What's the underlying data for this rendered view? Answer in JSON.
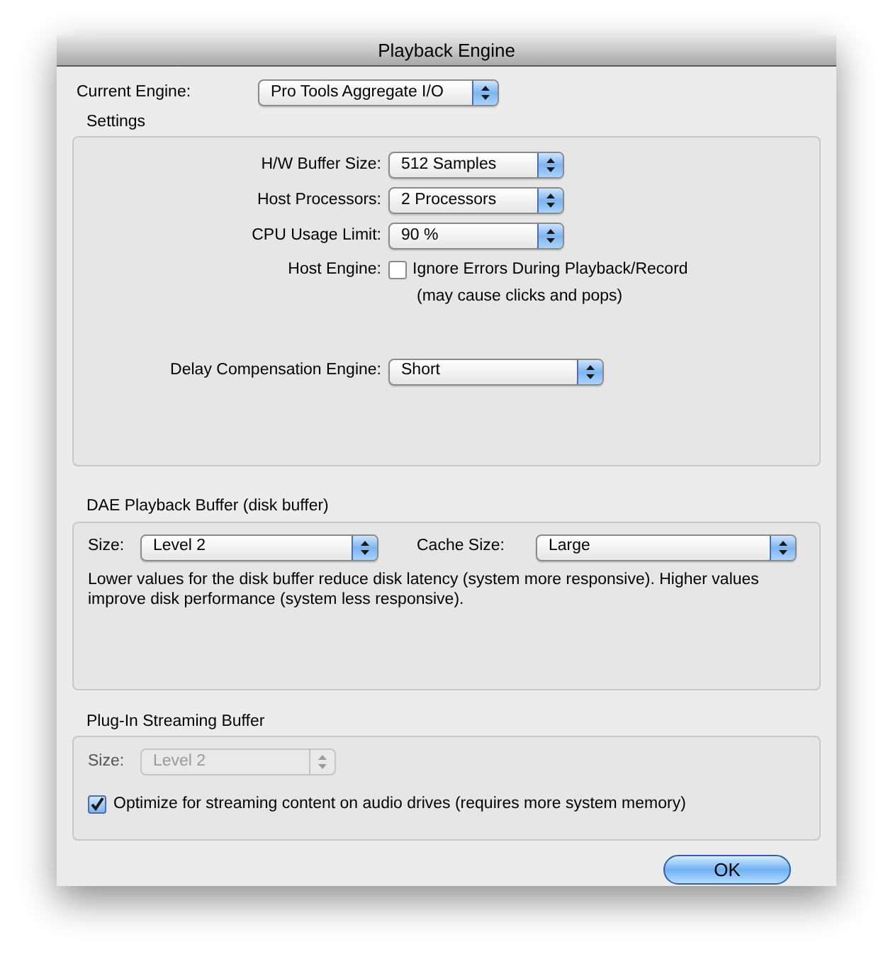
{
  "window": {
    "title": "Playback Engine"
  },
  "current_engine": {
    "label": "Current Engine:",
    "value": "Pro Tools Aggregate I/O"
  },
  "settings": {
    "title": "Settings",
    "rows": [
      {
        "kind": "select",
        "label": "H/W Buffer Size:",
        "value": "512 Samples"
      },
      {
        "kind": "select",
        "label": "Host Processors:",
        "value": "2 Processors"
      },
      {
        "kind": "select",
        "label": "CPU Usage Limit:",
        "value": "90 %"
      },
      {
        "kind": "checkbox",
        "label": "Host Engine:",
        "option": "Ignore Errors During Playback/Record",
        "checked": false,
        "note": "(may cause clicks and pops)"
      },
      {
        "kind": "wide_select",
        "label": "Delay Compensation Engine:",
        "value": "Short"
      }
    ]
  },
  "dae_buffer": {
    "title": "DAE Playback Buffer (disk buffer)",
    "size_label": "Size:",
    "size_value": "Level 2",
    "cache_label": "Cache Size:",
    "cache_value": "Large",
    "description": "Lower values for the disk buffer reduce disk latency (system more responsive).  Higher values improve disk performance (system less responsive)."
  },
  "plugin_buffer": {
    "title": "Plug-In Streaming Buffer",
    "size_label": "Size:",
    "size_value": "Level 2",
    "size_disabled": true,
    "option": "Optimize for streaming content on audio drives (requires more system memory)",
    "checked": true
  },
  "buttons": [
    {
      "label": "OK",
      "default": true
    }
  ]
}
